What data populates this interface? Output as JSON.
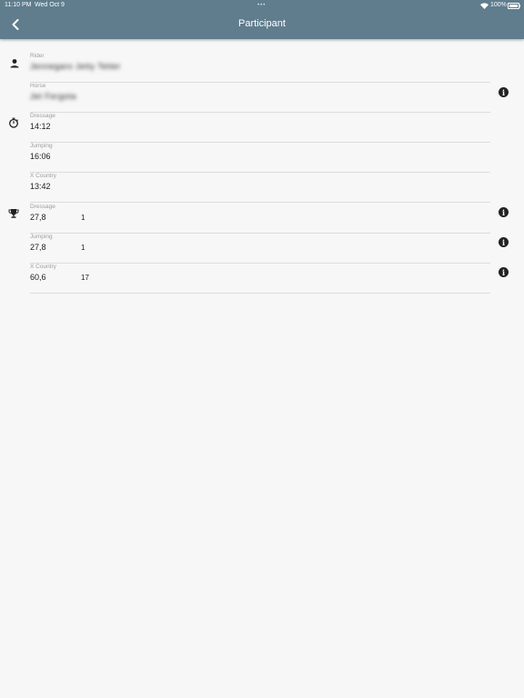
{
  "status_bar": {
    "time": "11:10 PM",
    "date": "Wed Oct 9",
    "battery": "100%"
  },
  "header": {
    "title": "Participant"
  },
  "person": {
    "rider_label": "Rider",
    "rider_value": "Jennegaro Jetty Tetter",
    "horse_label": "Horse",
    "horse_value": "Jet Fergota"
  },
  "times": [
    {
      "label": "Dressage",
      "value": "14:12"
    },
    {
      "label": "Jumping",
      "value": "16:06"
    },
    {
      "label": "X Country",
      "value": "13:42"
    }
  ],
  "scores": [
    {
      "label": "Dressage",
      "score": "27,8",
      "rank": "1"
    },
    {
      "label": "Jumping",
      "score": "27,8",
      "rank": "1"
    },
    {
      "label": "X Country",
      "score": "60,6",
      "rank": "17"
    }
  ],
  "colors": {
    "appbar": "#5f7d8d",
    "background": "#f7f7f7",
    "divider": "#dcdcdc"
  }
}
